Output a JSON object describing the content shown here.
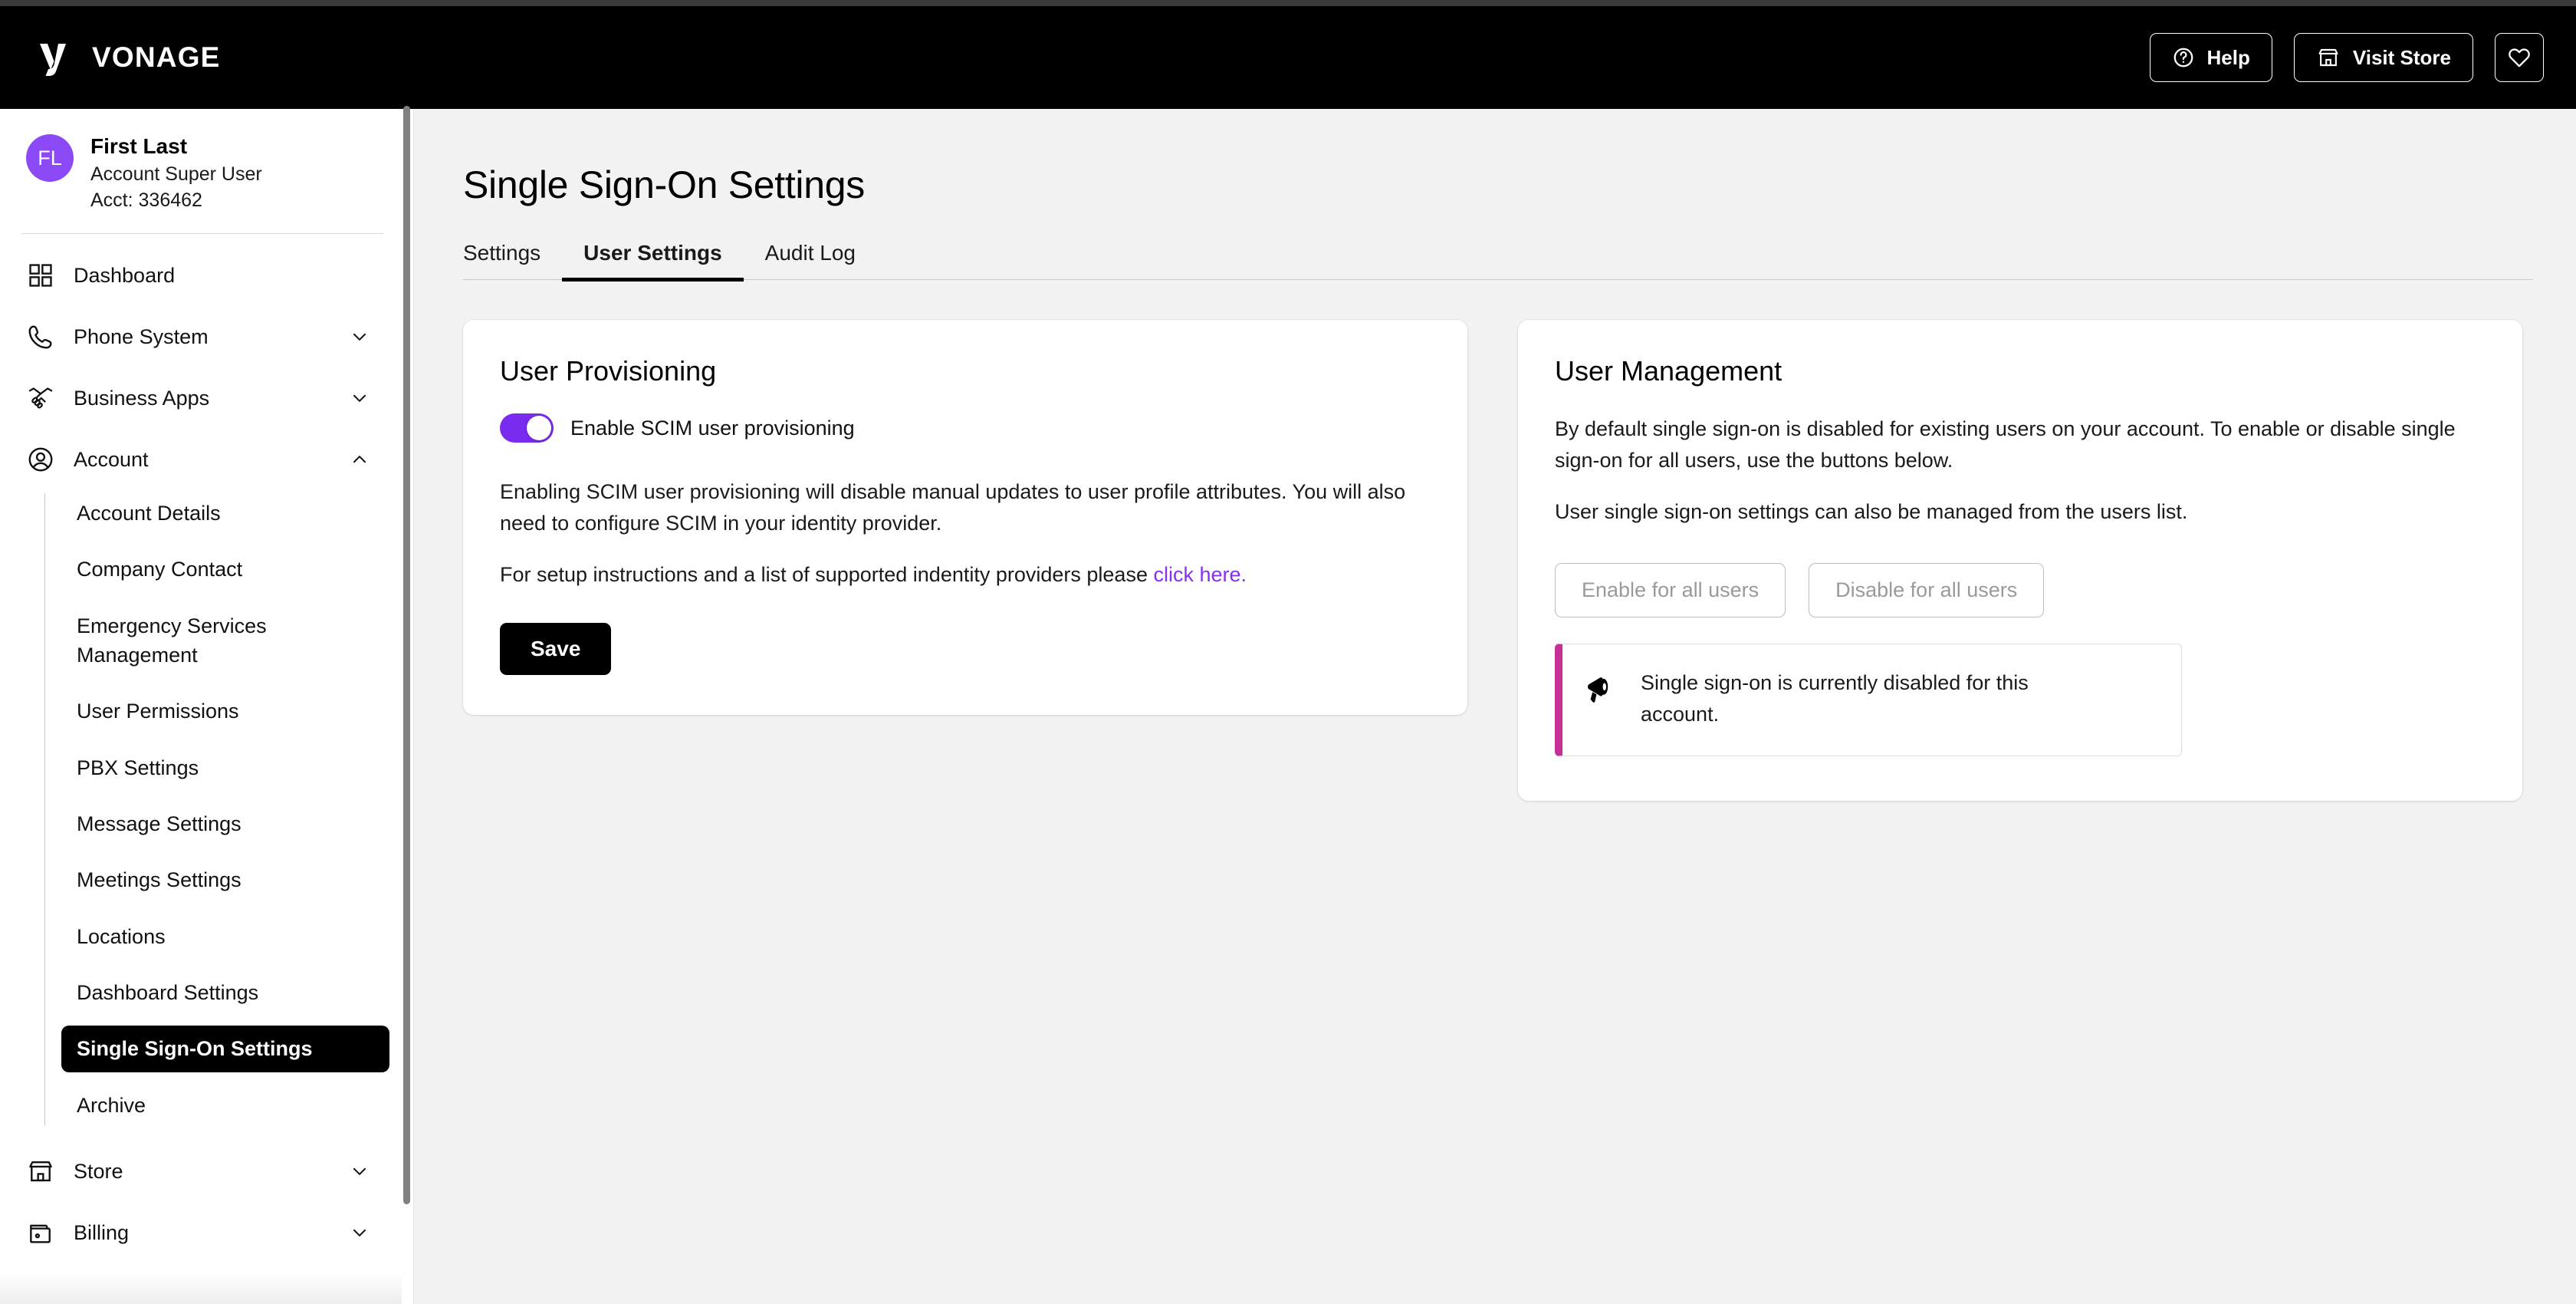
{
  "header": {
    "brand_name": "VONAGE",
    "brand_icon": "vonage-logo-icon",
    "help_label": "Help",
    "help_icon": "question-circle-icon",
    "store_label": "Visit Store",
    "store_icon": "storefront-icon",
    "favorites_icon": "heart-icon"
  },
  "sidebar": {
    "profile": {
      "initials": "FL",
      "name": "First Last",
      "role": "Account Super User",
      "account": "Acct: 336462"
    },
    "nav": [
      {
        "label": "Dashboard",
        "icon": "grid-icon",
        "expandable": false,
        "chevron": ""
      },
      {
        "label": "Phone System",
        "icon": "phone-icon",
        "expandable": true,
        "chevron": "chevron-down-icon"
      },
      {
        "label": "Business Apps",
        "icon": "handshake-icon",
        "expandable": true,
        "chevron": "chevron-down-icon"
      },
      {
        "label": "Account",
        "icon": "user-circle-icon",
        "expandable": true,
        "chevron": "chevron-up-icon"
      }
    ],
    "account_subnav": [
      {
        "label": "Account Details",
        "active": false
      },
      {
        "label": "Company Contact",
        "active": false
      },
      {
        "label": "Emergency Services Management",
        "active": false
      },
      {
        "label": "User Permissions",
        "active": false
      },
      {
        "label": "PBX Settings",
        "active": false
      },
      {
        "label": "Message Settings",
        "active": false
      },
      {
        "label": "Meetings Settings",
        "active": false
      },
      {
        "label": "Locations",
        "active": false
      },
      {
        "label": "Dashboard Settings",
        "active": false
      },
      {
        "label": "Single Sign-On Settings",
        "active": true
      },
      {
        "label": "Archive",
        "active": false
      }
    ],
    "nav_bottom": [
      {
        "label": "Store",
        "icon": "storefront-icon",
        "chevron": "chevron-down-icon"
      },
      {
        "label": "Billing",
        "icon": "wallet-icon",
        "chevron": "chevron-down-icon"
      }
    ]
  },
  "main": {
    "page_title": "Single Sign-On Settings",
    "tabs": [
      {
        "label": "Settings",
        "active": false
      },
      {
        "label": "User Settings",
        "active": true
      },
      {
        "label": "Audit Log",
        "active": false
      }
    ],
    "provisioning": {
      "title": "User Provisioning",
      "toggle_label": "Enable SCIM user provisioning",
      "toggle_on": true,
      "paragraph_1": "Enabling SCIM user provisioning will disable manual updates to user profile attributes. You will also need to configure SCIM in your identity provider.",
      "paragraph_2_prefix": "For setup instructions and a list of supported indentity providers please ",
      "link_text": "click here.",
      "save_label": "Save"
    },
    "management": {
      "title": "User Management",
      "paragraph_1": "By default single sign-on is disabled for existing users on your account. To enable or disable single sign-on for all users, use the buttons below.",
      "paragraph_2": "User single sign-on settings can also be managed from the users list.",
      "enable_label": "Enable for all users",
      "disable_label": "Disable for all users",
      "notice_icon": "megaphone-icon",
      "notice_text": "Single sign-on is currently disabled for this account."
    }
  },
  "colors": {
    "brand_black": "#000000",
    "avatar_purple": "#8B4AF5",
    "toggle_purple": "#7A2BF0",
    "link_purple": "#8630F0",
    "notice_accent_magenta": "#C62F96",
    "page_background": "#f2f2f2"
  }
}
